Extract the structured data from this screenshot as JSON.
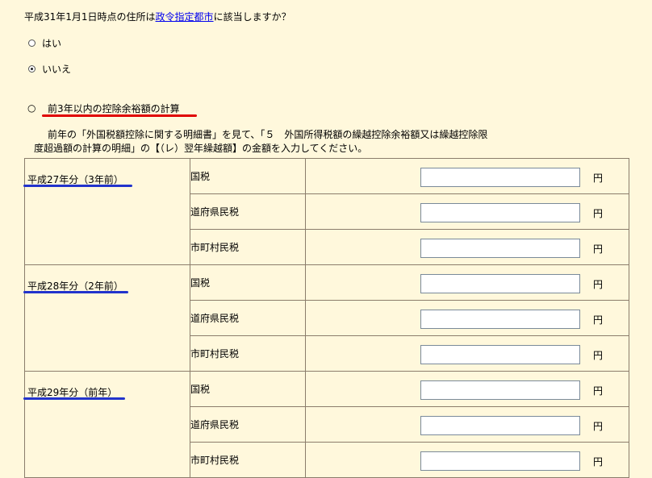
{
  "question": {
    "prefix": "平成31年1月1日時点の住所は",
    "link": "政令指定都市",
    "suffix": "に該当しますか？"
  },
  "options": [
    {
      "label": "はい",
      "checked": false
    },
    {
      "label": "いいえ",
      "checked": true
    }
  ],
  "calc_section": {
    "title": "前3年以内の控除余裕額の計算",
    "description_line1": "前年の「外国税額控除に関する明細書」を見て、「５　外国所得税額の繰越控除余裕額又は繰越控除限",
    "description_line2": "度超過額の計算の明細」の【（レ）翌年繰越額】の金額を入力してください。"
  },
  "years": [
    {
      "label": "平成27年分（3年前）",
      "rows": [
        {
          "tax": "国税",
          "value": "",
          "unit": "円"
        },
        {
          "tax": "道府県民税",
          "value": "",
          "unit": "円"
        },
        {
          "tax": "市町村民税",
          "value": "",
          "unit": "円"
        }
      ]
    },
    {
      "label": "平成28年分（2年前）",
      "rows": [
        {
          "tax": "国税",
          "value": "",
          "unit": "円"
        },
        {
          "tax": "道府県民税",
          "value": "",
          "unit": "円"
        },
        {
          "tax": "市町村民税",
          "value": "",
          "unit": "円"
        }
      ]
    },
    {
      "label": "平成29年分（前年）",
      "rows": [
        {
          "tax": "国税",
          "value": "",
          "unit": "円"
        },
        {
          "tax": "道府県民税",
          "value": "",
          "unit": "円"
        },
        {
          "tax": "市町村民税",
          "value": "",
          "unit": "円"
        }
      ]
    }
  ],
  "colors": {
    "background": "#FFF8DC",
    "link": "#0000EE",
    "red_underline": "#E00000",
    "blue_underline": "#2233CC",
    "border": "#8B7D6B"
  }
}
